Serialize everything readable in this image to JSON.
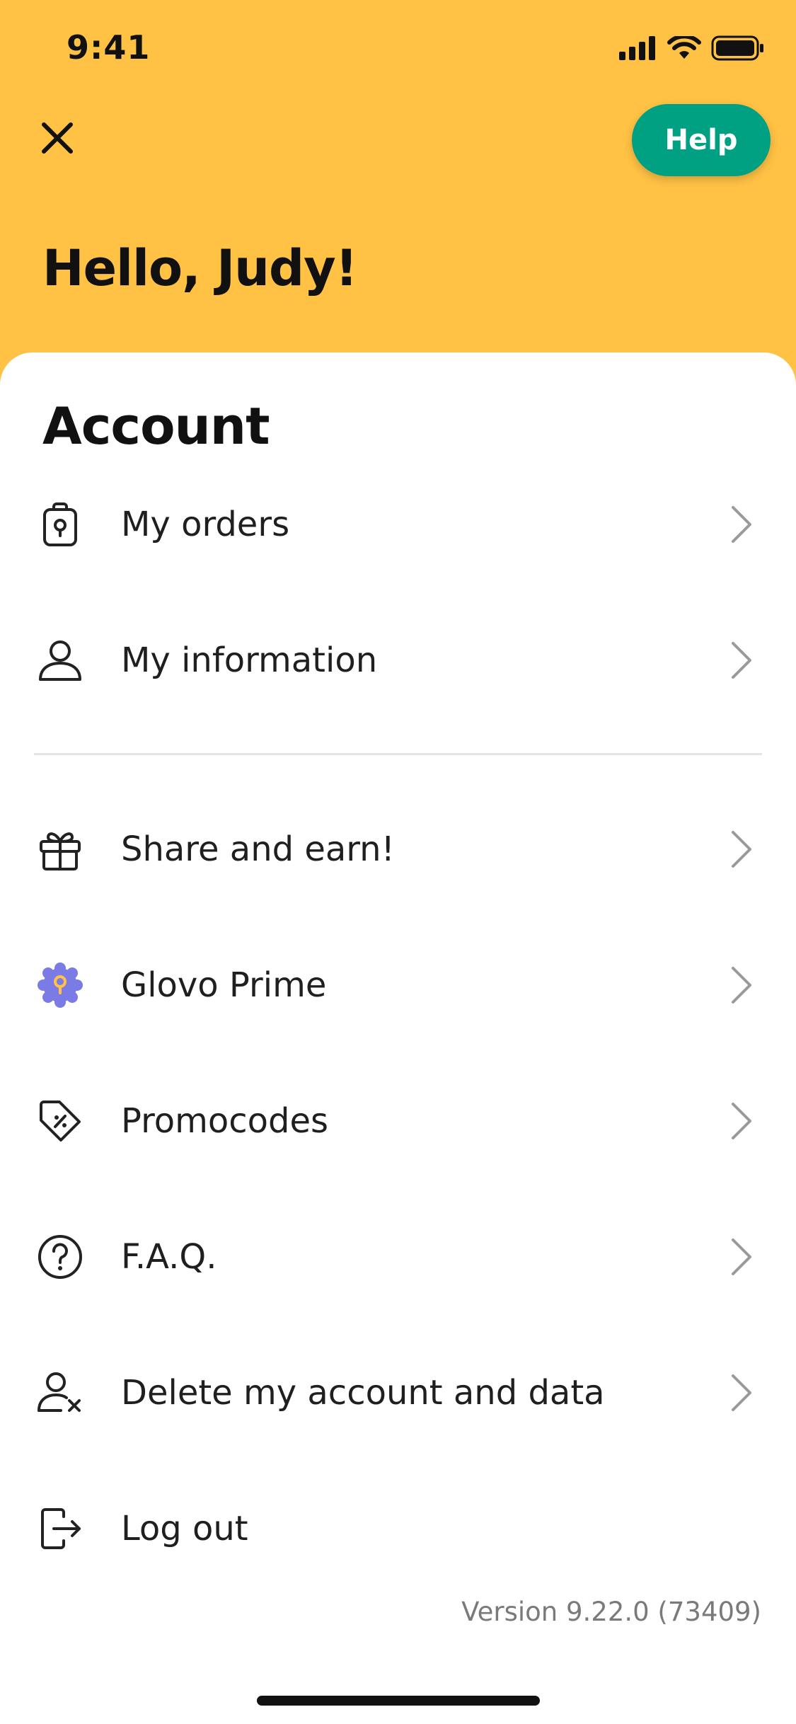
{
  "status_bar": {
    "time": "9:41"
  },
  "header": {
    "help_label": "Help",
    "greeting": "Hello, Judy!"
  },
  "account": {
    "title": "Account",
    "items": [
      {
        "label": "My orders",
        "icon": "shopping-bag-icon"
      },
      {
        "label": "My information",
        "icon": "user-icon"
      },
      {
        "label": "Share and earn!",
        "icon": "gift-icon"
      },
      {
        "label": "Glovo Prime",
        "icon": "prime-badge-icon"
      },
      {
        "label": "Promocodes",
        "icon": "discount-tag-icon"
      },
      {
        "label": "F.A.Q.",
        "icon": "question-icon"
      },
      {
        "label": "Delete my account and data",
        "icon": "delete-user-icon"
      },
      {
        "label": "Log out",
        "icon": "logout-icon"
      }
    ]
  },
  "version_text": "Version 9.22.0 (73409)",
  "colors": {
    "header_bg": "#FFC244",
    "help_bg": "#00A082",
    "prime_badge": "#7B7BE6",
    "prime_pin": "#FFC244"
  }
}
